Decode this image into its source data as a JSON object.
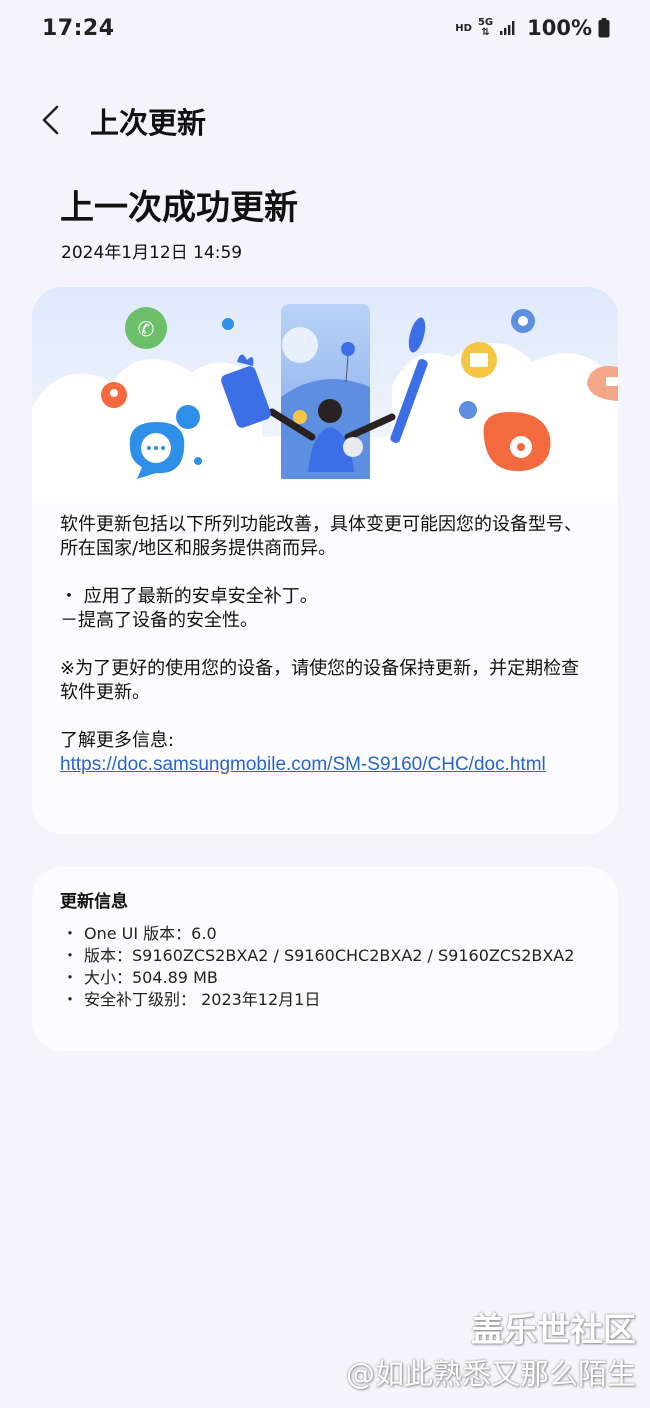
{
  "status_bar": {
    "time": "17:24",
    "hd": "HD",
    "network": "5G",
    "battery": "100%",
    "icons": [
      "signal-icon",
      "battery-icon"
    ]
  },
  "header": {
    "title": "上次更新",
    "back_icon": "chevron-left-icon"
  },
  "page": {
    "title": "上一次成功更新",
    "date": "2024年1月12日 14:59"
  },
  "update_card": {
    "illustration": "software-update-illustration",
    "intro": "软件更新包括以下所列功能改善，具体变更可能因您的设备型号、所在国家/地区和服务提供商而异。",
    "item1": "・ 应用了最新的安卓安全补丁。",
    "item2": "－提高了设备的安全性。",
    "note": "※为了更好的使用您的设备，请使您的设备保持更新，并定期检查软件更新。",
    "more_label": "了解更多信息:",
    "more_link": "https://doc.samsungmobile.com/SM-S9160/CHC/doc.html"
  },
  "info_card": {
    "heading": "更新信息",
    "bullet": "・",
    "items": [
      "One UI 版本：6.0",
      "版本：S9160ZCS2BXA2 / S9160CHC2BXA2 / S9160ZCS2BXA2",
      "大小：504.89 MB",
      "安全补丁级别：  2023年12月1日"
    ]
  },
  "watermark": {
    "line1": "盖乐世社区",
    "line2": "@如此熟悉又那么陌生"
  },
  "colors": {
    "background": "#f5f4fa",
    "card": "#fcfcfe",
    "link": "#2a65c9",
    "accent_blue": "#3c6ee6",
    "accent_orange": "#f26a3d",
    "accent_green": "#6cc06a"
  }
}
